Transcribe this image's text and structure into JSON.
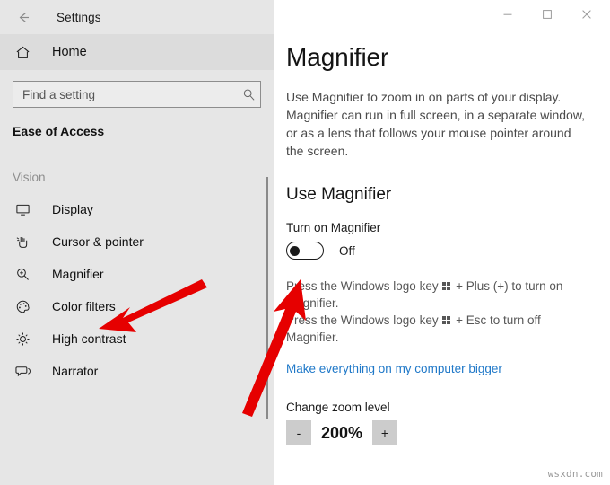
{
  "window": {
    "title": "Settings",
    "back_icon": "back-arrow-icon",
    "controls": {
      "minimize": "–",
      "maximize": "☐",
      "close": "✕"
    }
  },
  "sidebar": {
    "home": {
      "label": "Home",
      "icon": "home-icon"
    },
    "search": {
      "placeholder": "Find a setting",
      "value": "",
      "icon": "search-icon"
    },
    "category": "Ease of Access",
    "group_label": "Vision",
    "items": [
      {
        "label": "Display",
        "icon": "monitor-icon"
      },
      {
        "label": "Cursor & pointer",
        "icon": "cursor-pointer-icon"
      },
      {
        "label": "Magnifier",
        "icon": "magnifier-icon"
      },
      {
        "label": "Color filters",
        "icon": "palette-icon"
      },
      {
        "label": "High contrast",
        "icon": "brightness-icon"
      },
      {
        "label": "Narrator",
        "icon": "narrator-icon"
      }
    ]
  },
  "main": {
    "page_title": "Magnifier",
    "description": "Use Magnifier to zoom in on parts of your display. Magnifier can run in full screen, in a separate window, or as a lens that follows your mouse pointer around the screen.",
    "section_title": "Use Magnifier",
    "toggle": {
      "label": "Turn on Magnifier",
      "state": "Off",
      "on": false
    },
    "hints": {
      "line1_a": "Press the Windows logo key ",
      "line1_b": " + Plus (+) to turn on Magnifier.",
      "line2_a": "Press the Windows logo key ",
      "line2_b": " + Esc to turn off Magnifier."
    },
    "link": "Make everything on my computer bigger",
    "zoom": {
      "label": "Change zoom level",
      "decrement": "-",
      "value": "200%",
      "increment": "+"
    }
  },
  "watermark": "wsxdn.com",
  "colors": {
    "sidebar_bg": "#e6e6e6",
    "home_row_bg": "#dcdcdc",
    "link": "#1f78c8",
    "annotation_arrow": "#e60000",
    "text_primary": "#141414",
    "text_secondary": "#575757"
  },
  "annotations": [
    {
      "name": "arrow-to-magnifier",
      "color": "#e60000"
    },
    {
      "name": "arrow-to-toggle",
      "color": "#e60000"
    }
  ]
}
